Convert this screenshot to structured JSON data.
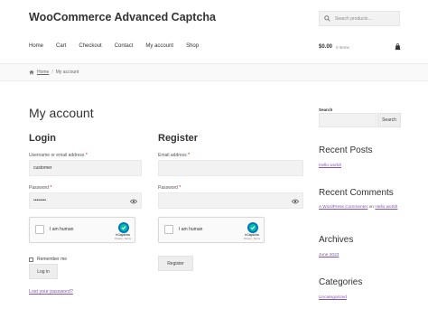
{
  "site": {
    "title": "WooCommerce Advanced Captcha"
  },
  "header_search": {
    "placeholder": "Search products…"
  },
  "nav": [
    "Home",
    "Cart",
    "Checkout",
    "Contact",
    "My account",
    "Shop"
  ],
  "cart": {
    "amount": "$0.00",
    "items": "0 items"
  },
  "breadcrumb": {
    "home": "Home",
    "current": "My account"
  },
  "page": {
    "title": "My account"
  },
  "login": {
    "title": "Login",
    "username_label": "Username or email address",
    "username_value": "customer",
    "password_label": "Password",
    "password_value": "••••••••",
    "captcha_text": "I am human",
    "captcha_brand": "hCaptcha",
    "captcha_links": "Privacy - Terms",
    "remember_label": "Remember me",
    "button": "Log in",
    "lost_password": "Lost your password?"
  },
  "register": {
    "title": "Register",
    "email_label": "Email address",
    "password_label": "Password",
    "captcha_text": "I am human",
    "captcha_brand": "hCaptcha",
    "captcha_links": "Privacy - Terms",
    "button": "Register"
  },
  "required_mark": "*",
  "sidebar": {
    "search_label": "Search",
    "search_button": "Search",
    "recent_posts_title": "Recent Posts",
    "recent_post": "Hello world!",
    "recent_comments_title": "Recent Comments",
    "comment_author": "A WordPress Commenter",
    "comment_on": "on",
    "comment_post": "Hello world!",
    "archives_title": "Archives",
    "archive_item": "June 2023",
    "categories_title": "Categories",
    "category_item": "Uncategorized"
  },
  "colors": {
    "link": "#7f54b3",
    "captcha_blue": "#0074bf",
    "captcha_teal": "#00bfa5"
  },
  "icons": [
    "search-icon",
    "shopping-bag-icon",
    "home-icon",
    "eye-icon",
    "hcaptcha-logo-icon"
  ]
}
